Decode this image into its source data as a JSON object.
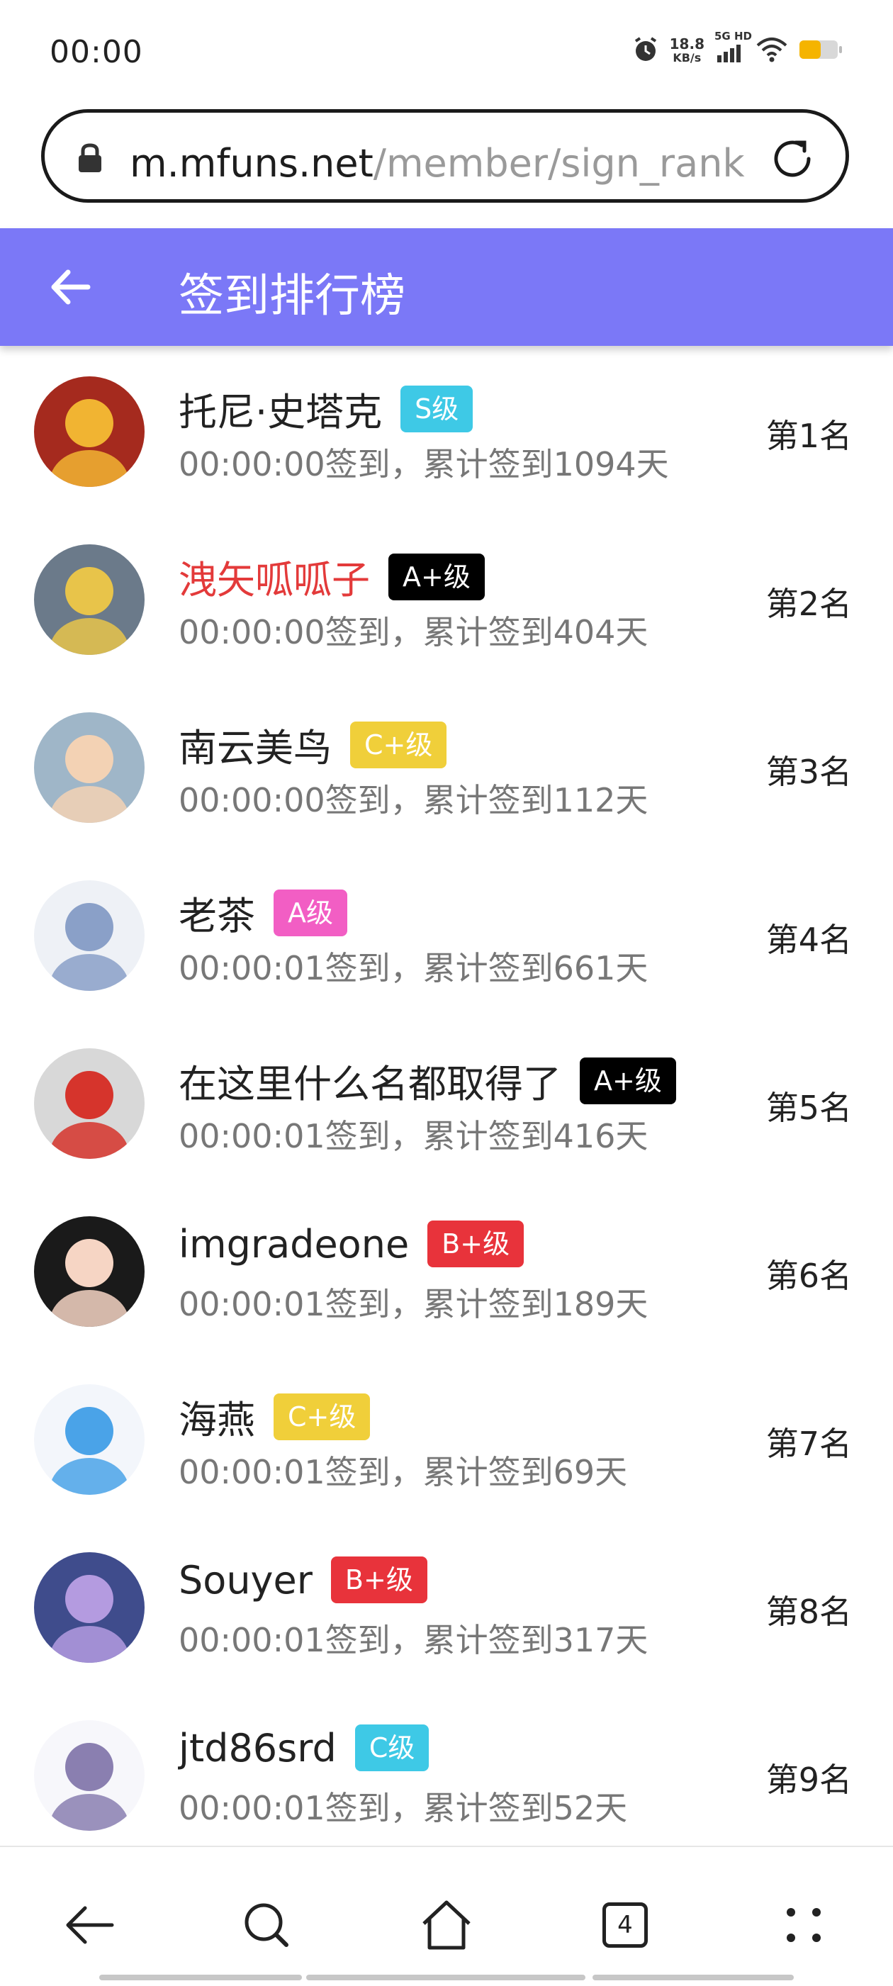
{
  "status_bar": {
    "time": "00:00",
    "net_speed_value": "18.8",
    "net_speed_unit": "KB/s",
    "network_label": "5G HD",
    "icons": [
      "alarm-icon",
      "signal-icon",
      "wifi-icon",
      "battery-icon"
    ]
  },
  "browser": {
    "url_host": "m.mfuns.net",
    "url_path": "/member/sign_rank",
    "tab_count": "4"
  },
  "header": {
    "title": "签到排行榜"
  },
  "colors": {
    "header_bg": "#7b78f7",
    "badge_S": "#3ec9e6",
    "badge_A_plus": "#000000",
    "badge_C_plus": "#f0cf3a",
    "badge_A": "#f25ec4",
    "badge_B_plus": "#e8333b",
    "badge_C": "#3ec9e6",
    "highlight_name": "#e33a3a"
  },
  "ranking": [
    {
      "name": "托尼·史塔克",
      "level": "S级",
      "level_color": "#3ec9e6",
      "detail": "00:00:00签到，累计签到1094天",
      "rank": "第1名",
      "name_highlight": false
    },
    {
      "name": "洩矢呱呱子",
      "level": "A+级",
      "level_color": "#000000",
      "detail": "00:00:00签到，累计签到404天",
      "rank": "第2名",
      "name_highlight": true
    },
    {
      "name": "南云美鸟",
      "level": "C+级",
      "level_color": "#f0cf3a",
      "detail": "00:00:00签到，累计签到112天",
      "rank": "第3名",
      "name_highlight": false
    },
    {
      "name": "老茶",
      "level": "A级",
      "level_color": "#f25ec4",
      "detail": "00:00:01签到，累计签到661天",
      "rank": "第4名",
      "name_highlight": false
    },
    {
      "name": "在这里什么名都取得了",
      "level": "A+级",
      "level_color": "#000000",
      "detail": "00:00:01签到，累计签到416天",
      "rank": "第5名",
      "name_highlight": false
    },
    {
      "name": "imgradeone",
      "level": "B+级",
      "level_color": "#e8333b",
      "detail": "00:00:01签到，累计签到189天",
      "rank": "第6名",
      "name_highlight": false
    },
    {
      "name": "海燕",
      "level": "C+级",
      "level_color": "#f0cf3a",
      "detail": "00:00:01签到，累计签到69天",
      "rank": "第7名",
      "name_highlight": false
    },
    {
      "name": "Souyer",
      "level": "B+级",
      "level_color": "#e8333b",
      "detail": "00:00:01签到，累计签到317天",
      "rank": "第8名",
      "name_highlight": false
    },
    {
      "name": "jtd86srd",
      "level": "C级",
      "level_color": "#3ec9e6",
      "detail": "00:00:01签到，累计签到52天",
      "rank": "第9名",
      "name_highlight": false
    }
  ],
  "bottom_nav": [
    "back-icon",
    "search-icon",
    "home-icon",
    "tabs-icon",
    "menu-icon"
  ]
}
